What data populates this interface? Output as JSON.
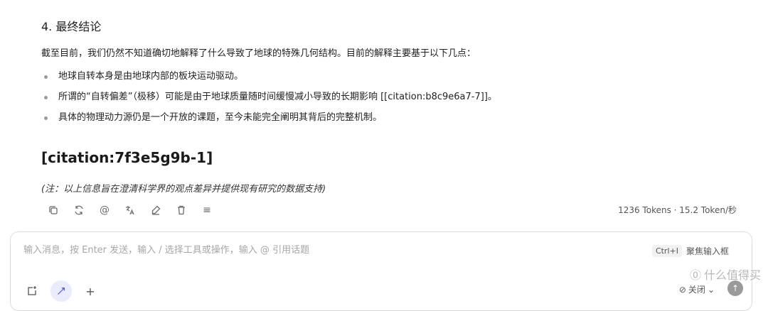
{
  "section": {
    "title": "4. 最终结论"
  },
  "intro": "截至目前，我们仍然不知道确切地解释了什么导致了地球的特殊几何结构。目前的解释主要基于以下几点：",
  "bullets": [
    "地球自转本身是由地球内部的板块运动驱动。",
    "所谓的“自转偏差”（极移）可能是由于地球质量随时间缓慢减小导致的长期影响 [[citation:b8c9e6a7-7]]。",
    "具体的物理动力源仍是一个开放的课题，至今未能完全阐明其背后的完整机制。"
  ],
  "citation_heading": "[citation:7f3e5g9b-1]",
  "note": "(注：以上信息旨在澄清科学界的观点差异并提供现有研究的数据支持)",
  "actions": [
    {
      "name": "copy-icon"
    },
    {
      "name": "regenerate-icon"
    },
    {
      "name": "mention-icon",
      "glyph": "@"
    },
    {
      "name": "translate-icon"
    },
    {
      "name": "edit-icon"
    },
    {
      "name": "delete-icon"
    },
    {
      "name": "more-icon",
      "glyph": "≡"
    }
  ],
  "tokens": "1236 Tokens · 15.2 Token/秒",
  "composer": {
    "placeholder": "输入消息，按 Enter 发送，输入 / 选择工具或操作，输入 @ 引用话题",
    "shortcut_key": "Ctrl+I",
    "shortcut_label": "聚焦输入框",
    "close_label": "关闭",
    "tools": [
      {
        "name": "new-topic-icon"
      },
      {
        "name": "mode-icon"
      },
      {
        "name": "add-icon",
        "glyph": "+"
      }
    ]
  },
  "watermark": "什么值得买"
}
